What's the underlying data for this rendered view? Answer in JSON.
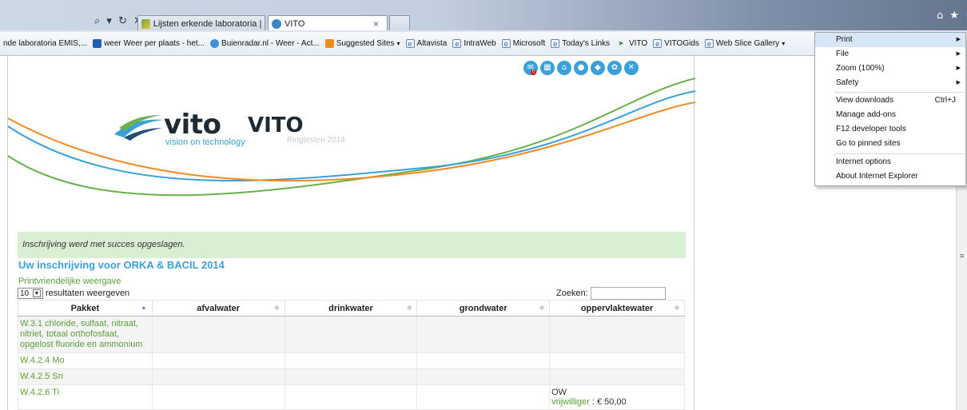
{
  "browser": {
    "address_icons": "⌕ ▾ ↻ ✕",
    "tabs": [
      {
        "label": "Lijsten erkende laboratoria | E...",
        "active": false
      },
      {
        "label": "VITO",
        "active": true,
        "close": "×"
      }
    ],
    "toolbar_icons": [
      "home-icon",
      "favorites-star-icon",
      "tools-gear-icon"
    ],
    "toolbar_glyphs": {
      "home": "⌂",
      "star": "★",
      "gear": "✹"
    }
  },
  "favorites": [
    {
      "label": "nde laboratoria  EMIS,...",
      "icon": "none"
    },
    {
      "label": "weer Weer per plaats - het...",
      "icon": "weer"
    },
    {
      "label": "Buienradar.nl - Weer - Act...",
      "icon": "buien"
    },
    {
      "label": "Suggested Sites",
      "icon": "sugg",
      "caret": "▾"
    },
    {
      "label": "Altavista",
      "icon": "page"
    },
    {
      "label": "IntraWeb",
      "icon": "page"
    },
    {
      "label": "Microsoft",
      "icon": "page"
    },
    {
      "label": "Today's Links",
      "icon": "page"
    },
    {
      "label": "VITO",
      "icon": "vito"
    },
    {
      "label": "VITOGids",
      "icon": "page"
    },
    {
      "label": "Web Slice Gallery",
      "icon": "page",
      "caret": "▾"
    }
  ],
  "site": {
    "nav_icons": [
      {
        "name": "messages-icon",
        "glyph": "✉",
        "badge": "0"
      },
      {
        "name": "calendar-icon",
        "glyph": "▦"
      },
      {
        "name": "home-icon",
        "glyph": "⌂"
      },
      {
        "name": "user-icon",
        "glyph": "●"
      },
      {
        "name": "tag-icon",
        "glyph": "◆"
      },
      {
        "name": "settings-icon",
        "glyph": "✿"
      },
      {
        "name": "close-icon",
        "glyph": "✕"
      }
    ],
    "logo_word": "vito",
    "logo_tagline": "vision on technology",
    "title": "VITO",
    "subtitle": "Ringtesten 2014",
    "curve_colors": {
      "green": "#6ab04c",
      "blue": "#3aa0d9",
      "orange": "#f08a24"
    }
  },
  "main": {
    "alert": "Inschrijving werd met succes opgeslagen.",
    "heading": "Uw inschrijving voor ORKA & BACIL 2014",
    "print_link": "Printvriendelijke weergave",
    "page_length": {
      "value": "10",
      "label": "resultaten weergeven"
    },
    "search": {
      "label": "Zoeken:",
      "value": ""
    },
    "table": {
      "columns": [
        "Pakket",
        "afvalwater",
        "drinkwater",
        "grondwater",
        "oppervlaktewater"
      ],
      "rows": [
        {
          "pakket": "W.3.1 chloride, sulfaat, nitraat, nitriet, totaal orthofosfaat, opgelost fluoride en ammonium",
          "cells": [
            "",
            "",
            "",
            ""
          ]
        },
        {
          "pakket": "W.4.2.4 Mo",
          "cells": [
            "",
            "",
            "",
            ""
          ]
        },
        {
          "pakket": "W.4.2.5 Sn",
          "cells": [
            "",
            "",
            "",
            ""
          ]
        },
        {
          "pakket": "W.4.2.6 Ti",
          "cells": [
            "",
            "",
            "",
            ""
          ],
          "last_cell": {
            "line1": "OW",
            "link": "vrijwilliger",
            "rest": " : € 50,00"
          }
        }
      ]
    }
  },
  "tools_menu": {
    "items": [
      {
        "label": "Print",
        "arrow": "▶",
        "hover": true
      },
      {
        "label": "File",
        "arrow": "▶"
      },
      {
        "label": "Zoom (100%)",
        "arrow": "▶"
      },
      {
        "label": "Safety",
        "arrow": "▶"
      },
      {
        "label": "View downloads",
        "shortcut": "Ctrl+J"
      },
      {
        "label": "Manage add-ons"
      },
      {
        "label": "F12 developer tools"
      },
      {
        "label": "Go to pinned sites"
      },
      {
        "label": "Internet options"
      },
      {
        "label": "About Internet Explorer"
      }
    ]
  }
}
